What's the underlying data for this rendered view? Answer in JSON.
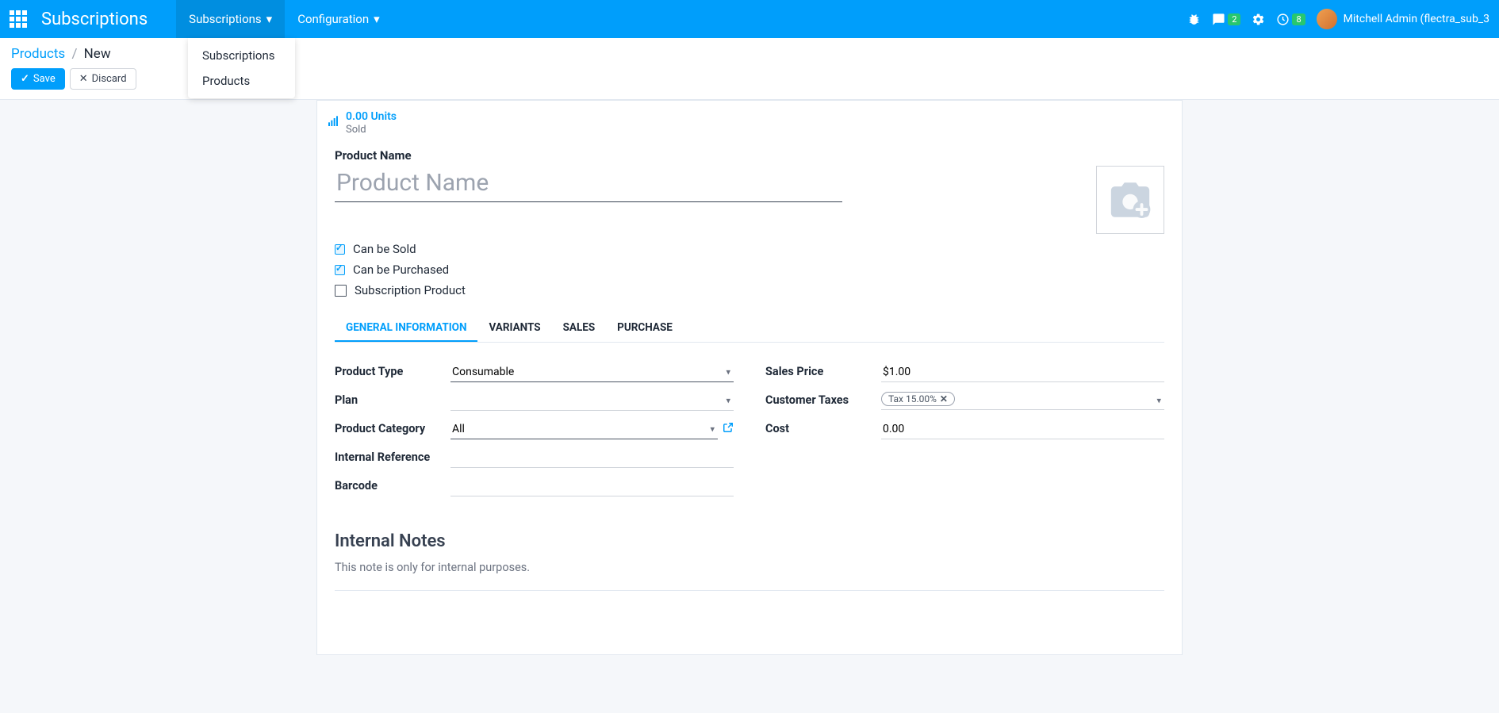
{
  "navbar": {
    "app_title": "Subscriptions",
    "menu": [
      {
        "label": "Subscriptions",
        "active": true
      },
      {
        "label": "Configuration",
        "active": false
      }
    ],
    "dropdown": [
      "Subscriptions",
      "Products"
    ],
    "badges": {
      "messages": "2",
      "activities": "8"
    },
    "user": "Mitchell Admin (flectra_sub_3"
  },
  "breadcrumb": {
    "parent": "Products",
    "current": "New"
  },
  "buttons": {
    "save": "Save",
    "discard": "Discard"
  },
  "stat": {
    "value": "0.00 Units",
    "label": "Sold"
  },
  "form": {
    "title_label": "Product Name",
    "title_placeholder": "Product Name",
    "checks": {
      "sold": "Can be Sold",
      "purchased": "Can be Purchased",
      "subscription": "Subscription Product"
    },
    "tabs": [
      "GENERAL INFORMATION",
      "VARIANTS",
      "SALES",
      "PURCHASE"
    ],
    "left": {
      "product_type": {
        "label": "Product Type",
        "value": "Consumable"
      },
      "plan": {
        "label": "Plan",
        "value": ""
      },
      "category": {
        "label": "Product Category",
        "value": "All"
      },
      "internal_ref": {
        "label": "Internal Reference",
        "value": ""
      },
      "barcode": {
        "label": "Barcode",
        "value": ""
      }
    },
    "right": {
      "sales_price": {
        "label": "Sales Price",
        "value": "$1.00"
      },
      "customer_taxes": {
        "label": "Customer Taxes",
        "tag": "Tax 15.00%"
      },
      "cost": {
        "label": "Cost",
        "value": "0.00"
      }
    },
    "notes": {
      "title": "Internal Notes",
      "placeholder": "This note is only for internal purposes."
    }
  }
}
